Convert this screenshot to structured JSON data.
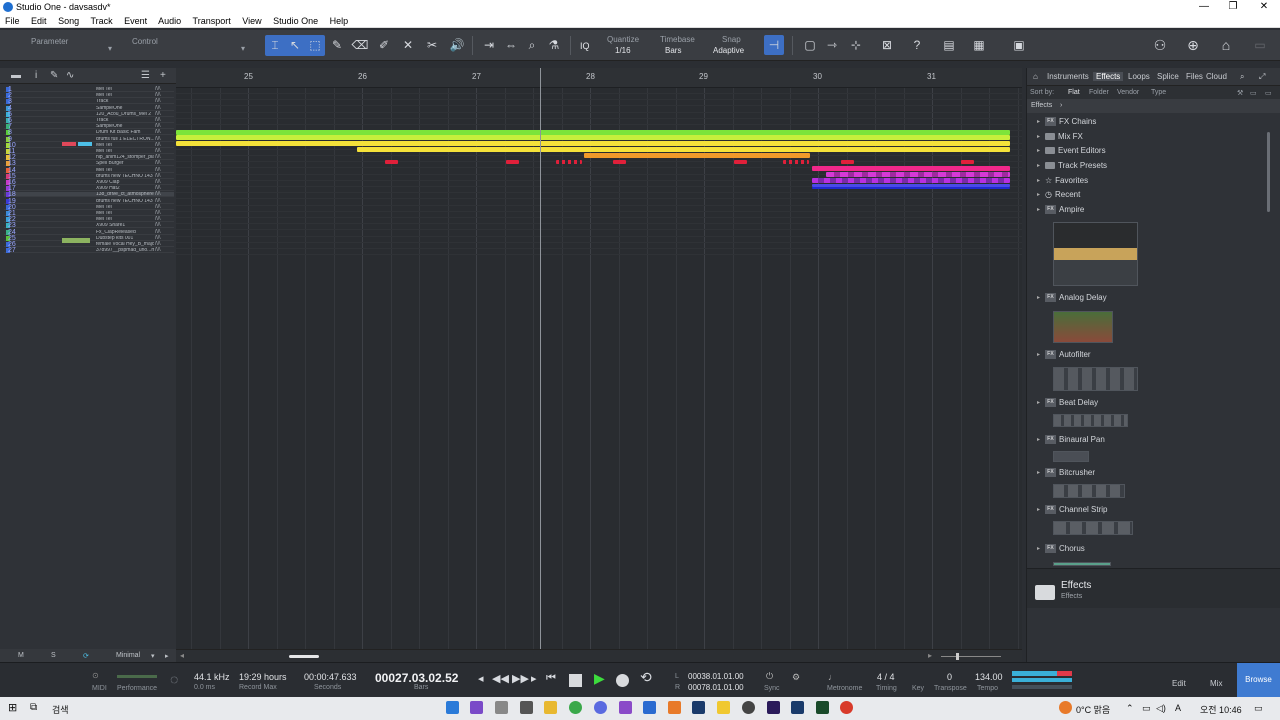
{
  "window": {
    "title": "Studio One - davsasdv*",
    "min": "—",
    "max": "❐",
    "close": "✕"
  },
  "menu": [
    "File",
    "Edit",
    "Song",
    "Track",
    "Event",
    "Audio",
    "Transport",
    "View",
    "Studio One",
    "Help"
  ],
  "toolbar": {
    "parameter": "Parameter",
    "control": "Control",
    "iq": "IQ",
    "quantize_label": "Quantize",
    "quantize_value": "1/16",
    "timebase_label": "Timebase",
    "timebase_value": "Bars",
    "snap_label": "Snap",
    "snap_value": "Adaptive"
  },
  "ruler": [
    "25",
    "26",
    "27",
    "28",
    "29",
    "30",
    "31"
  ],
  "tracks": [
    {
      "num": "1",
      "name": "Mel Tel"
    },
    {
      "num": "2",
      "name": "Mel Tel"
    },
    {
      "num": "3",
      "name": "Track"
    },
    {
      "num": "4",
      "name": "SampleOne"
    },
    {
      "num": "5",
      "name": "120_Acou_Drums_Mel 2"
    },
    {
      "num": "6",
      "name": "Track"
    },
    {
      "num": "7",
      "name": "SampleOne"
    },
    {
      "num": "8",
      "name": "Drum Kit Basic Fam"
    },
    {
      "num": "9",
      "name": "drums full 1 ELECTRON...100"
    },
    {
      "num": "10",
      "name": "Mel Tel"
    },
    {
      "num": "11",
      "name": "Mel Tel"
    },
    {
      "num": "12",
      "name": "hip_anim124_stomper_piano"
    },
    {
      "num": "13",
      "name": "Spell Burger"
    },
    {
      "num": "14",
      "name": "Mel Tel"
    },
    {
      "num": "15",
      "name": "drums new TECHNO 143"
    },
    {
      "num": "16",
      "name": "X909 Clap"
    },
    {
      "num": "17",
      "name": "X909 Hat2"
    },
    {
      "num": "18",
      "name": "138_drive_ct_atmosphere t"
    },
    {
      "num": "19",
      "name": "drums new TECHNO 143"
    },
    {
      "num": "20",
      "name": "Mel Tel"
    },
    {
      "num": "21",
      "name": "Mel Tel"
    },
    {
      "num": "22",
      "name": "Mel Tel"
    },
    {
      "num": "23",
      "name": "X909 Snare1"
    },
    {
      "num": "24",
      "name": "Fx_ClapReleased"
    },
    {
      "num": "25",
      "name": "Dubstep kits 001"
    },
    {
      "num": "26",
      "name": "female Vocal Hey_B_major"
    },
    {
      "num": "27",
      "name": "378997__pspmad_uno...mor"
    }
  ],
  "tracklist_footer": {
    "m": "M",
    "s": "S",
    "minimal": "Minimal"
  },
  "browser": {
    "tabs": [
      "Instruments",
      "Effects",
      "Loops",
      "Splice",
      "Files",
      "Cloud"
    ],
    "sort_by": "Sort by:",
    "sort_opts": [
      "Flat",
      "Folder",
      "Vendor",
      "Type"
    ],
    "crumb": "Effects",
    "folders": [
      "FX Chains",
      "Mix FX",
      "Event Editors",
      "Track Presets",
      "Favorites",
      "Recent"
    ],
    "plugins": [
      "Ampire",
      "Analog Delay",
      "Autofilter",
      "Beat Delay",
      "Binaural Pan",
      "Bitcrusher",
      "Channel Strip",
      "Chorus"
    ],
    "fx_badge": "FX",
    "footer_title": "Effects",
    "footer_sub": "Effects"
  },
  "transport": {
    "midi": "MIDI",
    "performance": "Performance",
    "sample_rate": "44.1 kHz",
    "latency": "0.0 ms",
    "record_time": "19:29 hours",
    "record_max": "Record Max",
    "seconds_time": "00:00:47.633",
    "seconds": "Seconds",
    "bars_time": "00027.03.02.52",
    "bars": "Bars",
    "loop_l": "00038.01.01.00",
    "loop_r": "00078.01.01.00",
    "l": "L",
    "r": "R",
    "sync": "Sync",
    "metronome": "Metronome",
    "timing": "Timing",
    "sig": "4 / 4",
    "key": "Key",
    "transpose_val": "0",
    "transpose": "Transpose",
    "tempo_val": "134.00",
    "tempo": "Tempo",
    "edit": "Edit",
    "mix": "Mix",
    "browse": "Browse"
  },
  "taskbar": {
    "search": "검색",
    "weather": "0°C 맑음",
    "time": "오전 10:46"
  }
}
